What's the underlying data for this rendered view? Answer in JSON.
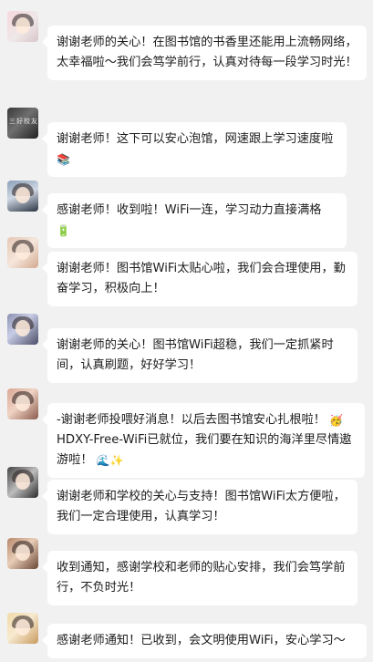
{
  "messages": [
    {
      "text": "谢谢老师的关心！在图书馆的书香里还能用上流畅网络，太幸福啦～我们会笃学前行，认真对待每一段学习时光！",
      "avatar_icon": "user-avatar-icon"
    },
    {
      "text": "谢谢老师！这下可以安心泡馆，网速跟上学习速度啦",
      "emoji": "📚",
      "avatar_icon": "user-avatar-icon",
      "avatar_caption": "三好校友"
    },
    {
      "text": "感谢老师！收到啦！WiFi一连，学习动力直接满格",
      "emoji": "🔋",
      "avatar_icon": "user-avatar-icon"
    },
    {
      "text": " 谢谢老师！图书馆WiFi太贴心啦，我们会合理使用，勤奋学习，积极向上！",
      "avatar_icon": "user-avatar-icon"
    },
    {
      "text": "谢谢老师的关心！图书馆WiFi超稳，我们一定抓紧时间，认真刷题，好好学习！",
      "avatar_icon": "user-avatar-icon"
    },
    {
      "text": "-谢谢老师投喂好消息！以后去图书馆安心扎根啦！",
      "emoji": "🥳",
      "text2": "HDXY-Free-WiFi已就位，我们要在知识的海洋里尽情遨游啦！",
      "emoji2": "🌊✨",
      "avatar_icon": "user-avatar-icon"
    },
    {
      "text": "谢谢老师和学校的关心与支持！图书馆WiFi太方便啦，我们一定合理使用，认真学习！",
      "avatar_icon": "user-avatar-icon"
    },
    {
      "text": "收到通知，感谢学校和老师的贴心安排，我们会笃学前行，不负时光！",
      "avatar_icon": "user-avatar-icon"
    },
    {
      "text": "感谢老师通知！已收到，会文明使用WiFi，安心学习～",
      "avatar_icon": "user-avatar-icon"
    }
  ],
  "colors": {
    "background": "#f1f1f1",
    "bubble": "#ffffff",
    "text": "#1c1c1c"
  }
}
